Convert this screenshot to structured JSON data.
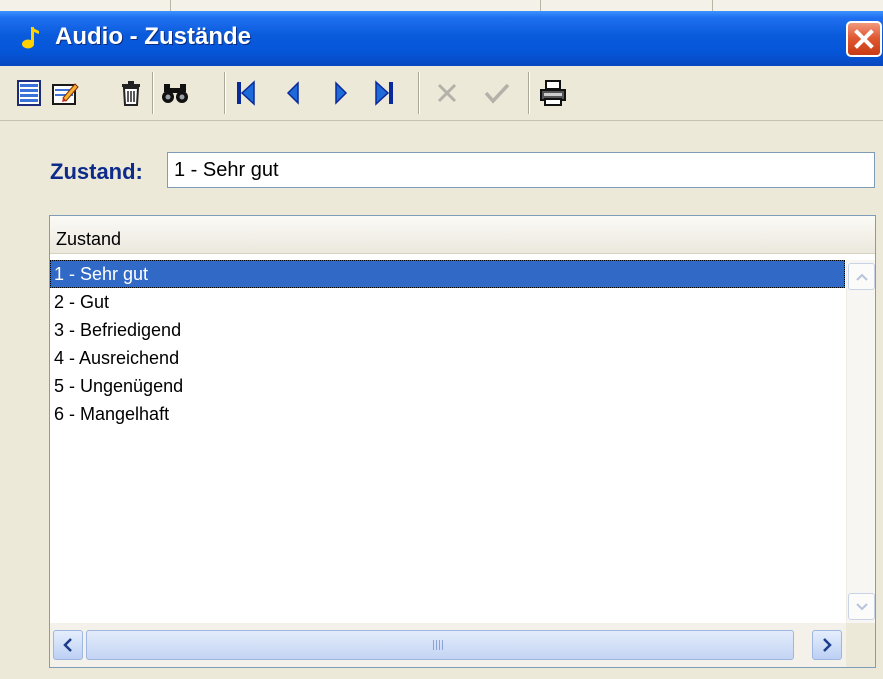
{
  "window": {
    "title": "Audio - Zustände",
    "accent_color": "#0a5bdc",
    "icon": "music-note-icon"
  },
  "toolbar": {
    "buttons": [
      {
        "name": "new-record-icon"
      },
      {
        "name": "edit-record-icon"
      },
      {
        "name": "delete-record-icon"
      },
      {
        "name": "search-binoculars-icon"
      },
      {
        "name": "first-record-icon"
      },
      {
        "name": "previous-record-icon"
      },
      {
        "name": "next-record-icon"
      },
      {
        "name": "last-record-icon"
      },
      {
        "name": "cancel-icon",
        "disabled": true
      },
      {
        "name": "confirm-checkmark-icon",
        "disabled": true
      },
      {
        "name": "print-icon"
      }
    ]
  },
  "form": {
    "label": "Zustand:",
    "value": "1 - Sehr gut"
  },
  "list": {
    "header": "Zustand",
    "items": [
      {
        "label": "1 - Sehr gut",
        "selected": true
      },
      {
        "label": "2 - Gut"
      },
      {
        "label": "3 - Befriedigend"
      },
      {
        "label": "4 - Ausreichend"
      },
      {
        "label": "5 - Ungenügend"
      },
      {
        "label": "6 - Mangelhaft"
      }
    ],
    "selection_color": "#3169c6"
  }
}
